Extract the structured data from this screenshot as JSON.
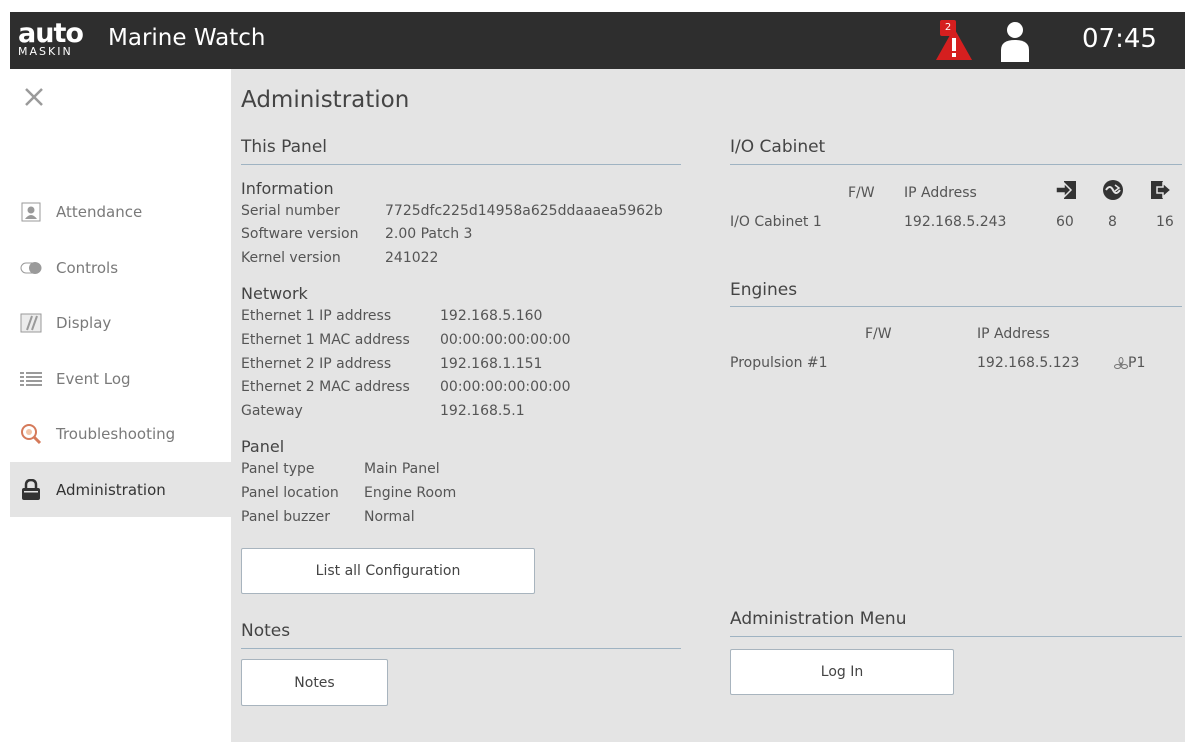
{
  "header": {
    "logo_text": "auto",
    "logo_subtext": "MASKIN",
    "app_title": "Marine Watch",
    "alarm_count": "2",
    "clock": "07:45"
  },
  "sidebar": {
    "items": [
      {
        "label": "Attendance",
        "icon": "person-icon"
      },
      {
        "label": "Controls",
        "icon": "toggle-icon"
      },
      {
        "label": "Display",
        "icon": "display-icon"
      },
      {
        "label": "Event Log",
        "icon": "list-icon"
      },
      {
        "label": "Troubleshooting",
        "icon": "troubleshoot-icon"
      },
      {
        "label": "Administration",
        "icon": "lock-icon",
        "active": true
      }
    ]
  },
  "main": {
    "title": "Administration",
    "this_panel": {
      "title": "This Panel",
      "information": {
        "heading": "Information",
        "rows": [
          {
            "label": "Serial number",
            "value": "7725dfc225d14958a625ddaaaea5962b"
          },
          {
            "label": "Software version",
            "value": "2.00 Patch 3"
          },
          {
            "label": "Kernel version",
            "value": "241022"
          }
        ]
      },
      "network": {
        "heading": "Network",
        "rows": [
          {
            "label": "Ethernet 1 IP address",
            "value": "192.168.5.160"
          },
          {
            "label": "Ethernet 1 MAC address",
            "value": "00:00:00:00:00:00"
          },
          {
            "label": "Ethernet 2 IP address",
            "value": "192.168.1.151"
          },
          {
            "label": "Ethernet 2 MAC address",
            "value": "00:00:00:00:00:00"
          },
          {
            "label": "Gateway",
            "value": "192.168.5.1"
          }
        ]
      },
      "panel": {
        "heading": "Panel",
        "rows": [
          {
            "label": "Panel type",
            "value": "Main Panel"
          },
          {
            "label": "Panel location",
            "value": "Engine Room"
          },
          {
            "label": "Panel buzzer",
            "value": "Normal"
          }
        ]
      },
      "list_config_button": "List all Configuration"
    },
    "notes": {
      "title": "Notes",
      "button": "Notes"
    },
    "io_cabinet": {
      "title": "I/O Cabinet",
      "col_fw": "F/W",
      "col_ip": "IP Address",
      "rows": [
        {
          "name": "I/O Cabinet 1",
          "fw": "",
          "ip": "192.168.5.243",
          "inputs": "60",
          "analog": "8",
          "outputs": "16"
        }
      ]
    },
    "engines": {
      "title": "Engines",
      "col_fw": "F/W",
      "col_ip": "IP Address",
      "rows": [
        {
          "name": "Propulsion #1",
          "fw": "",
          "ip": "192.168.5.123",
          "tag": "P1"
        }
      ]
    },
    "admin_menu": {
      "title": "Administration Menu",
      "login_button": "Log In"
    }
  }
}
